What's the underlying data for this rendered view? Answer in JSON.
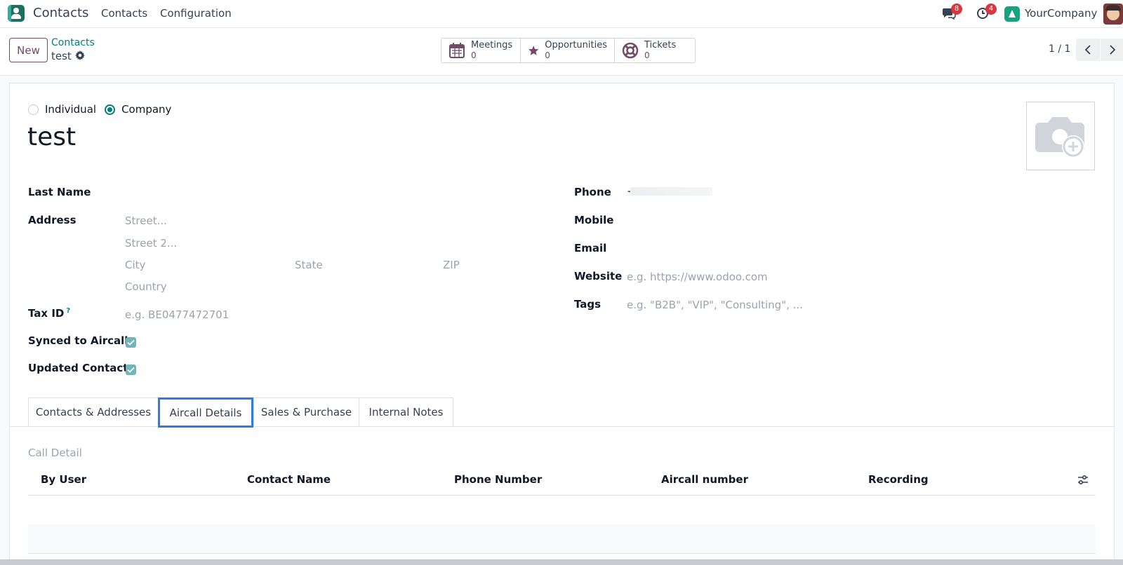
{
  "app": {
    "name": "Contacts"
  },
  "nav": {
    "items": [
      "Contacts",
      "Configuration"
    ]
  },
  "systray": {
    "messages_count": "8",
    "activities_count": "4",
    "company": "YourCompany"
  },
  "control": {
    "new_label": "New",
    "breadcrumb_parent": "Contacts",
    "breadcrumb_current": "test",
    "pager": "1 / 1"
  },
  "smart_buttons": [
    {
      "label": "Meetings",
      "value": "0",
      "icon": "calendar-icon"
    },
    {
      "label": "Opportunities",
      "value": "0",
      "icon": "star-icon"
    },
    {
      "label": "Tickets",
      "value": "0",
      "icon": "lifebuoy-icon"
    }
  ],
  "form": {
    "type_options": [
      "Individual",
      "Company"
    ],
    "type_selected": "Company",
    "name": "test",
    "left": {
      "last_name_label": "Last Name",
      "address_label": "Address",
      "street_ph": "Street...",
      "street2_ph": "Street 2...",
      "city_ph": "City",
      "state_ph": "State",
      "zip_ph": "ZIP",
      "country_ph": "Country",
      "tax_label": "Tax ID",
      "tax_help": "?",
      "tax_ph": "e.g. BE0477472701",
      "synced_label": "Synced to Aircall",
      "synced_value": true,
      "updated_label": "Updated Contact",
      "updated_value": true
    },
    "right": {
      "phone_label": "Phone",
      "phone_value": "+",
      "mobile_label": "Mobile",
      "email_label": "Email",
      "website_label": "Website",
      "website_ph": "e.g. https://www.odoo.com",
      "tags_label": "Tags",
      "tags_ph": "e.g. \"B2B\", \"VIP\", \"Consulting\", ..."
    }
  },
  "tabs": [
    {
      "label": "Contacts & Addresses",
      "active": false
    },
    {
      "label": "Aircall Details",
      "active": true
    },
    {
      "label": "Sales & Purchase",
      "active": false
    },
    {
      "label": "Internal Notes",
      "active": false
    }
  ],
  "aircall": {
    "section_title": "Call Detail",
    "columns": [
      "By User",
      "Contact Name",
      "Phone Number",
      "Aircall number",
      "Recording"
    ]
  },
  "colors": {
    "brand": "#714b67",
    "accent": "#017e84",
    "tab_highlight": "#2f7be0",
    "badge": "#d9363e"
  }
}
